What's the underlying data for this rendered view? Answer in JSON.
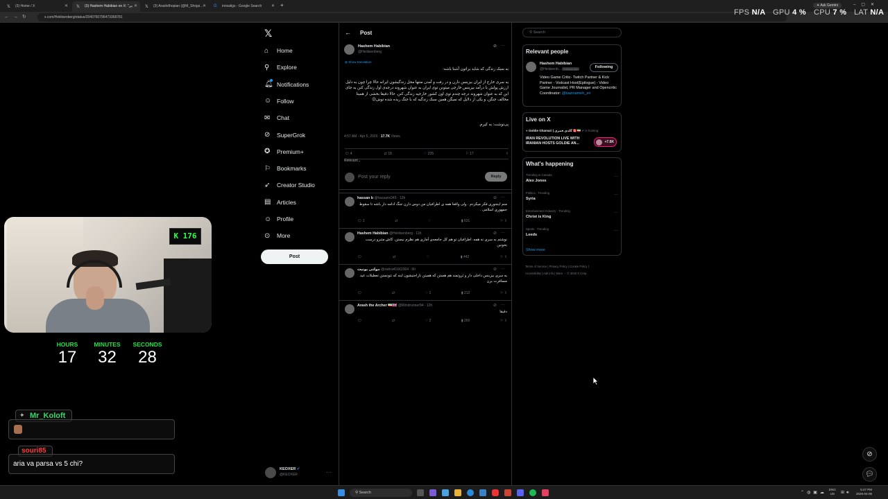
{
  "browser": {
    "tabs": [
      {
        "label": "(3) Home / X",
        "icon": "x-logo-icon"
      },
      {
        "label": "(3) Hashem Habibian on X: \"بی",
        "icon": "x-logo-icon"
      },
      {
        "label": "(3) Arashdhopian (@M_Shojai...",
        "icon": "x-logo-icon"
      },
      {
        "label": "innsaligs - Google Search",
        "icon": "google-icon"
      }
    ],
    "url": "x.com/Heiiiisenberg/status/2040760796473368781",
    "gemini_label": "Ask Gemini"
  },
  "perf": {
    "fps_label": "FPS",
    "fps": "N/A",
    "gpu_label": "GPU",
    "gpu": "4 %",
    "cpu_label": "CPU",
    "cpu": "7 %",
    "lat_label": "LAT",
    "lat": "N/A"
  },
  "nav": {
    "items": [
      {
        "label": "Home",
        "icon": "home-icon"
      },
      {
        "label": "Explore",
        "icon": "search-icon"
      },
      {
        "label": "Notifications",
        "icon": "bell-icon"
      },
      {
        "label": "Follow",
        "icon": "add-user-icon"
      },
      {
        "label": "Chat",
        "icon": "chat-icon"
      },
      {
        "label": "SuperGrok",
        "icon": "grok-icon"
      },
      {
        "label": "Premium+",
        "icon": "premium-icon"
      },
      {
        "label": "Bookmarks",
        "icon": "bookmark-icon"
      },
      {
        "label": "Creator Studio",
        "icon": "rocket-icon"
      },
      {
        "label": "Articles",
        "icon": "article-icon"
      },
      {
        "label": "Profile",
        "icon": "profile-icon"
      },
      {
        "label": "More",
        "icon": "more-circle-icon"
      }
    ],
    "post_label": "Post",
    "me_name": "KEOXER",
    "me_handle": "@KEOXER"
  },
  "post": {
    "header_title": "Post",
    "author": "Hashem Habibian",
    "handle": "@Heiiiisenberg",
    "show_translation": "Show translation",
    "line1": "به سبک زندگی که شاید براتون آشنا باشه:",
    "body": "یه سری خارج از ایران بیزینس دارن و در رفت و آمدن منتها محل زندگیشون ایرانه حالا چرا چون به دلیل ارزش پولش با درآمد بیزینس خارجی میتونن توی ایران به عنوان شهروند درجه‌ی اول زندگی کنن به جای این که به عنوان شهروند درجه چندم توی اون کشور خارجیه زندگی کنن. حالا دقیقا بخشی از همینا مخالف جنگن. و یکی از دلایل که نمیگن همین سبک زندگیه که با جنگ ریده شده توش😕",
    "ps": "پی‌نوشت: به کیرم.",
    "time": "4:57 AM · Apr 5, 2026 · ",
    "views": "17.7K",
    "views_label": "Views",
    "replies": "4",
    "reposts": "18",
    "likes": "235",
    "bookmarks": "17",
    "sort_label": "Relevant",
    "reply_placeholder": "Post your reply",
    "reply_button": "Reply"
  },
  "replies": [
    {
      "name": "hassan b",
      "handle": "@hassanv345 · 12h",
      "text": "منم اینجوری فکر میکردم . ولی واقعا همه ی اطرافیان من دوس دارن جنگ ادامه دار باشه تا سقوط جمهوری اسلامی .",
      "replies": "1",
      "reposts": "",
      "likes": "",
      "views": "631"
    },
    {
      "name": "Hashem Habibian",
      "handle": "@Heiiiisenberg · 11h",
      "text": "نوشتم به سری نه همه. اطرافیان تو هم کل جامعه‌ی آماری هم نظرم نیستن. کاش متنرو درست بخونین",
      "replies": "",
      "reposts": "",
      "likes": "",
      "views": "442"
    },
    {
      "name": "مولتی یونیت",
      "handle": "@zahra41662364 · 6h",
      "text": "یه سری بیزینس داخلی دار و ثروتمند هم هستن که همینن ناراحتیشون اینه که نتونستن تعطیلات عید مسافرت برن",
      "replies": "",
      "reposts": "",
      "likes": "1",
      "views": "212"
    },
    {
      "name": "Arash the Archer 🇮🇷🇬🇧",
      "handle": "@Windrunner94 · 12h",
      "text": "دقیقا",
      "replies": "",
      "reposts": "",
      "likes": "2",
      "views": "260"
    }
  ],
  "right": {
    "search_placeholder": "Search",
    "relevant_title": "Relevant people",
    "rp_name": "Hashem Habibian",
    "rp_handle": "@Heiiiisenb...",
    "rp_follows": "Follows you",
    "rp_follow_btn": "Following",
    "rp_bio": "Video Game Critic- Twitch Partner & Kick Partner - Vodcast Host(Epilogue) - Video Game Journalist, PR Manager and Opencritic Coordinator:",
    "rp_link": "@bazinameh_en",
    "live_title": "Live on X",
    "live_host": "Goldie Ghamari | گلدی قمری 🇨🇦🇮🇷",
    "live_status": "is hosting",
    "live_text": "IRAN REVOLUTION LIVE WITH IRANIAN HOSTS GOLDIE AN...",
    "live_count": "+7.6K",
    "happening_title": "What's happening",
    "trends": [
      {
        "meta": "Trending in Canada",
        "title": "Alex Jones"
      },
      {
        "meta": "Politics · Trending",
        "title": "Syria"
      },
      {
        "meta": "Entertainment Industry · Trending",
        "title": "Christ is King"
      },
      {
        "meta": "Sports · Trending",
        "title": "Leeds"
      }
    ],
    "show_more": "Show more",
    "footer1": "Terms of Service  |  Privacy Policy  |  Cookie Policy  |",
    "footer2": "Accessibility  |  Ads info  |  More ···  © 2026 X Corp."
  },
  "overlay": {
    "webcam_badge": "K 176",
    "hours_label": "HOURS",
    "hours": "17",
    "minutes_label": "MINUTES",
    "minutes": "32",
    "seconds_label": "SECONDS",
    "seconds": "28",
    "chat1_name": "Mr_Koloft",
    "chat2_name": "souri85",
    "chat2_msg": "aria va parsa vs 5 chi?"
  },
  "taskbar": {
    "search": "Search",
    "lang1": "ENG",
    "lang2": "US",
    "time": "5:47 PM",
    "date": "2026-04-05"
  },
  "colors": {
    "accent": "#1d9bf0",
    "timer_green": "#22e04a",
    "chat_name": "#31d96a",
    "live_pink": "#f91880"
  }
}
